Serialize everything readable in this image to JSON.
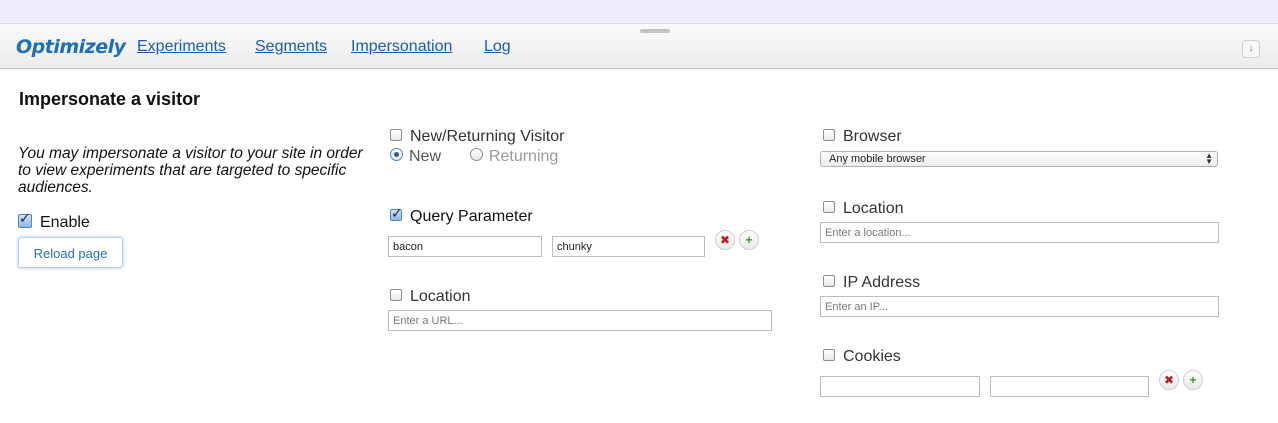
{
  "nav": {
    "brand": "Optimizely",
    "links": [
      "Experiments",
      "Segments",
      "Impersonation",
      "Log"
    ],
    "collapse_icon": "double-chevron-down-icon"
  },
  "page": {
    "title": "Impersonate a visitor",
    "intro": "You may impersonate a visitor to your site in order to view experiments that are targeted to specific audiences.",
    "enable_label": "Enable",
    "enable_checked": true,
    "reload_label": "Reload page"
  },
  "visitor": {
    "label": "New/Returning Visitor",
    "checked": false,
    "options": [
      "New",
      "Returning"
    ],
    "selected": "New"
  },
  "query": {
    "label": "Query Parameter",
    "checked": true,
    "key_value": "bacon",
    "val_value": "chunky"
  },
  "location_url": {
    "label": "Location",
    "checked": false,
    "placeholder": "Enter a URL..."
  },
  "browser": {
    "label": "Browser",
    "checked": false,
    "selected": "Any mobile browser"
  },
  "geo": {
    "label": "Location",
    "checked": false,
    "placeholder": "Enter a location..."
  },
  "ip": {
    "label": "IP Address",
    "checked": false,
    "placeholder": "Enter an IP..."
  },
  "cookies": {
    "label": "Cookies",
    "checked": false
  },
  "icons": {
    "remove": "✖",
    "add": "+"
  },
  "colors": {
    "link": "#1c5ea8",
    "brand": "#1f6fb5",
    "remove": "#b0221f",
    "add": "#3a9a2a"
  }
}
